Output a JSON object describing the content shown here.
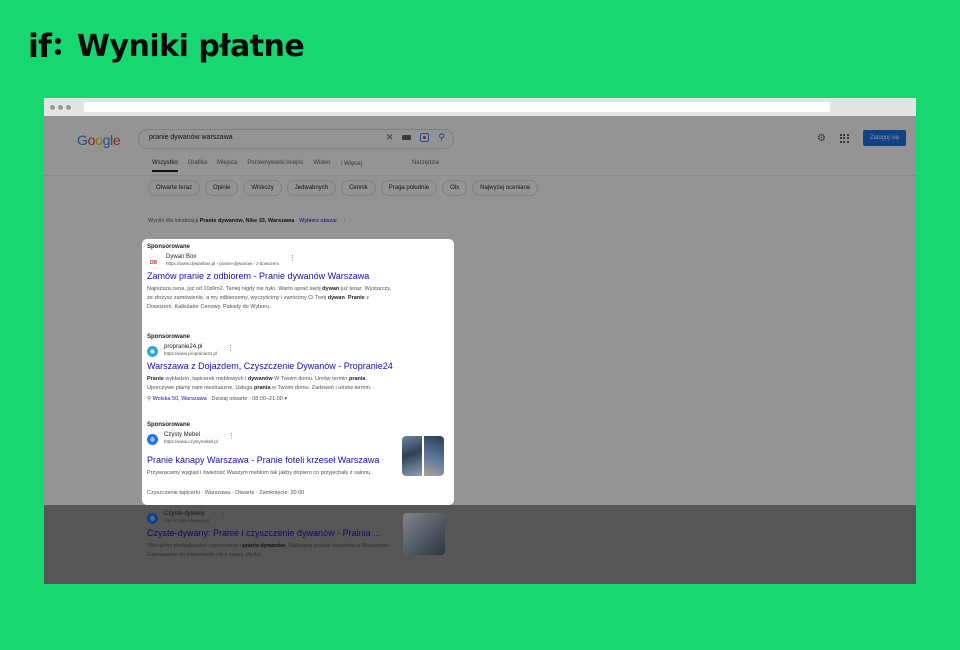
{
  "header": {
    "logo": "if",
    "headline": "Wyniki płatne"
  },
  "google": {
    "logo_letters": [
      {
        "ch": "G",
        "color": "#4285f4"
      },
      {
        "ch": "o",
        "color": "#ea4335"
      },
      {
        "ch": "o",
        "color": "#fbbc05"
      },
      {
        "ch": "g",
        "color": "#4285f4"
      },
      {
        "ch": "l",
        "color": "#34a853"
      },
      {
        "ch": "e",
        "color": "#ea4335"
      }
    ],
    "query": "pranie dywanów warszawa",
    "clear_glyph": "✕",
    "search_glyph": "⚲",
    "settings_glyph": "⚙",
    "signin": "Zaloguj się"
  },
  "tabs": [
    "Wszystko",
    "Grafika",
    "Miejsca",
    "Porównywarki miejsc",
    "Wideo",
    "⁝ Więcej"
  ],
  "tools": "Narzędzia",
  "chips": [
    "Otwarte teraz",
    "Opinie",
    "Wiskozy",
    "Jedwabnych",
    "Cennik",
    "Praga południe",
    "Olx",
    "Najwyżej oceniane"
  ],
  "location": {
    "prefix": "Wyniki dla lokalizacji",
    "place": "Pranie dywanów, Nike 33, Warszawa",
    "sep": " · ",
    "link": "Wybierz obszar",
    "menu": "⋮"
  },
  "ads": [
    {
      "label": "Sponsorowane",
      "favicon": "dyw",
      "site": "Dywan Box",
      "url": "https://www.dywanbox.pl › pranie-dywanów › z-dowozem",
      "menu": "⋮",
      "title": "Zamów pranie z odbiorem - Pranie dywanów Warszawa",
      "desc": [
        {
          "t": "Najniższa cena, już od 10zł/m2. Taniej nigdy nie było. Warto uprać swój "
        },
        {
          "t": "dywan",
          "b": true
        },
        {
          "t": " już teraz. Wystarczy, że złożysz zamówienie, a my odbierzemy, wyczyścimy i zwrócimy Ci Twój "
        },
        {
          "t": "dywan",
          "b": true
        },
        {
          "t": ". "
        },
        {
          "t": "Pranie",
          "b": true
        },
        {
          "t": " z Dowozem. Kalkulator Cenowy. Pakiety do Wyboru."
        }
      ]
    },
    {
      "label": "Sponsorowane",
      "favicon": "◉",
      "site": "propranie24.pl",
      "url": "https://www.propranie24.pl",
      "menu": "⋮",
      "title": "Warszawa z Dojazdem, Czyszczenie Dywanów - Propranie24",
      "desc": [
        {
          "t": "Pranie",
          "b": true
        },
        {
          "t": " wykładzin, tapicerek meblowych i "
        },
        {
          "t": "dywanów",
          "b": true
        },
        {
          "t": " W Twoim domu. Umów termin "
        },
        {
          "t": "prania",
          "b": true
        },
        {
          "t": ". Uporczywe plamy nam niestraszne. Usługa "
        },
        {
          "t": "prania",
          "b": true
        },
        {
          "t": " w Twoim domu. Zadzwoń i umów termin."
        }
      ],
      "extra_pin": "⚲",
      "extra_loc": "Wolska 50, Warszawa",
      "extra_rest": " · Dzisiaj otwarte · 08:00–21:00 ▾"
    },
    {
      "label": "Sponsorowane",
      "favicon": "◍",
      "site": "Czysty Mebel",
      "url": "https://www.czystymebel.pl",
      "menu": "⋮",
      "title": "Pranie kanapy Warszawa - Pranie foteli krzeseł Warszawa",
      "desc": [
        {
          "t": "Przywracamy wygląd i świeżość Waszym meblom tak jakby dopiero co przyjechały z salonu."
        }
      ],
      "extra": "Czyszczenie tapicerki · Warszawa · Otwarte · Zamknięcie: 20:00"
    }
  ],
  "organic": {
    "favicon": "◍",
    "site": "Czyste-dywany",
    "url": "http://czyste-dywany.pl",
    "menu": "⋮",
    "title": "Czyste-dywany: Pranie i czyszczenie dywanów - Pralnia ...",
    "desc": [
      {
        "t": "Oferujemy profesjonalne czyszczenie i "
      },
      {
        "t": "pranie dywanów",
        "b": true
      },
      {
        "t": ". Najlepsza pralnia dywanów w Warszawie. Zapraszamy do zapoznania się z naszą ofertą!"
      }
    ]
  },
  "colors": {
    "background": "#17d870",
    "link": "#1a0dab",
    "google_blue": "#1a73e8",
    "overlay": "rgba(0,0,0,0.42)"
  }
}
